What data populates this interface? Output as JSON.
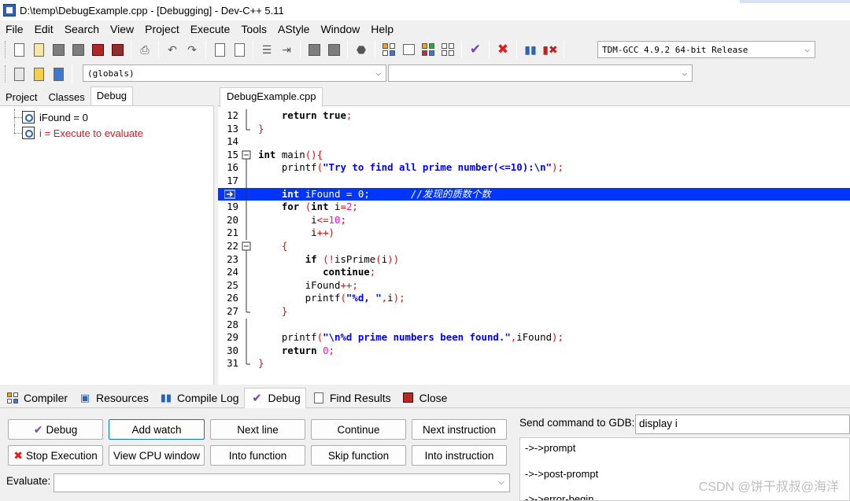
{
  "window": {
    "title": "D:\\temp\\DebugExample.cpp - [Debugging] - Dev-C++ 5.11"
  },
  "menu": [
    "File",
    "Edit",
    "Search",
    "View",
    "Project",
    "Execute",
    "Tools",
    "AStyle",
    "Window",
    "Help"
  ],
  "toolbar": {
    "compiler_select": "TDM-GCC 4.9.2 64-bit Release",
    "scope_select": "(globals)",
    "function_select": ""
  },
  "left_panel": {
    "tabs": [
      "Project",
      "Classes",
      "Debug"
    ],
    "active_tab": "Debug",
    "watches": [
      {
        "text": "iFound = 0",
        "color": "#000000"
      },
      {
        "text": "i = Execute to evaluate",
        "color": "#e81123"
      }
    ]
  },
  "editor": {
    "tab": "DebugExample.cpp",
    "lines": [
      {
        "n": "12",
        "html": "    <span class=\"kw\">return</span> <span class=\"kw\">true</span><span class=\"sym\">;</span>"
      },
      {
        "n": "13",
        "html": "<span class=\"sym\">}</span>"
      },
      {
        "n": "14",
        "html": ""
      },
      {
        "n": "15",
        "html": "<span class=\"kw\">int</span> main<span class=\"sym\">(){</span>"
      },
      {
        "n": "16",
        "html": "    printf<span class=\"sym\">(</span><span class=\"str\">\"Try to find all prime number(&lt;=10):\\n\"</span><span class=\"sym\">);</span>"
      },
      {
        "n": "17",
        "html": ""
      },
      {
        "n": "18",
        "html": "    <span class=\"kw\">int</span> iFound <span class=\"sym\">=</span> <span class=\"num\">0</span><span class=\"sym\">;</span>       <span class=\"cmt\">//发现的质数个数</span>"
      },
      {
        "n": "19",
        "html": "    <span class=\"kw\">for</span> <span class=\"sym\">(</span><span class=\"kw\">int</span> i<span class=\"sym\">=</span><span class=\"num\">2</span><span class=\"sym\">;</span>"
      },
      {
        "n": "20",
        "html": "         i<span class=\"sym\">&lt;=</span><span class=\"num\">10</span><span class=\"sym\">;</span>"
      },
      {
        "n": "21",
        "html": "         i<span class=\"sym\">++)</span>"
      },
      {
        "n": "22",
        "html": "    <span class=\"sym\">{</span>"
      },
      {
        "n": "23",
        "html": "        <span class=\"kw\">if</span> <span class=\"sym\">(!</span>isPrime<span class=\"sym\">(</span>i<span class=\"sym\">))</span>"
      },
      {
        "n": "24",
        "html": "           <span class=\"kw\">continue</span><span class=\"sym\">;</span>"
      },
      {
        "n": "25",
        "html": "        iFound<span class=\"sym\">++;</span>"
      },
      {
        "n": "26",
        "html": "        printf<span class=\"sym\">(</span><span class=\"str\">\"%d, \"</span><span class=\"sym\">,</span>i<span class=\"sym\">);</span>"
      },
      {
        "n": "27",
        "html": "    <span class=\"sym\">}</span>"
      },
      {
        "n": "28",
        "html": ""
      },
      {
        "n": "29",
        "html": "    printf<span class=\"sym\">(</span><span class=\"str\">\"\\n%d prime numbers been found.\"</span><span class=\"sym\">,</span>iFound<span class=\"sym\">);</span>"
      },
      {
        "n": "30",
        "html": "    <span class=\"kw\">return</span> <span class=\"num\">0</span><span class=\"sym\">;</span>"
      },
      {
        "n": "31",
        "html": "<span class=\"sym\">}</span>"
      }
    ]
  },
  "bottom_tabs": [
    {
      "label": "Compiler",
      "icon": "compiler-icon"
    },
    {
      "label": "Resources",
      "icon": "resources-icon"
    },
    {
      "label": "Compile Log",
      "icon": "compile-log-icon"
    },
    {
      "label": "Debug",
      "icon": "debug-check-icon"
    },
    {
      "label": "Find Results",
      "icon": "find-results-icon"
    },
    {
      "label": "Close",
      "icon": "close-tab-icon"
    }
  ],
  "debug_panel": {
    "buttons": {
      "debug": "Debug",
      "add_watch": "Add watch",
      "next_line": "Next line",
      "continue": "Continue",
      "next_instruction": "Next instruction",
      "stop_execution": "Stop Execution",
      "view_cpu": "View CPU window",
      "into_function": "Into function",
      "skip_function": "Skip function",
      "into_instruction": "Into instruction"
    },
    "evaluate_label": "Evaluate:",
    "evaluate_value": "",
    "gdb_label": "Send command to GDB:",
    "gdb_value": "display i",
    "gdb_output": [
      "->->prompt",
      "->->post-prompt",
      "->->error-begin"
    ]
  },
  "watermark": "CSDN @饼干叔叔@海洋"
}
